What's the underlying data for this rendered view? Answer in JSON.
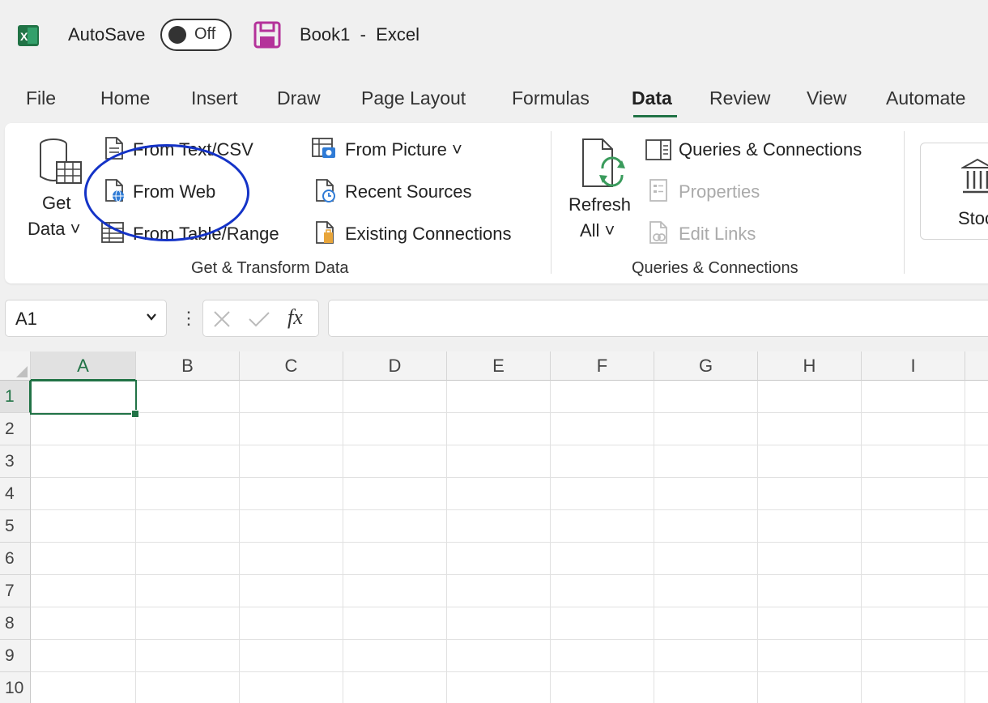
{
  "titlebar": {
    "autosave_label": "AutoSave",
    "autosave_state": "Off",
    "doc_title": "Book1  -  Excel",
    "icons": [
      "excel-logo-icon",
      "save-icon"
    ],
    "colors": {
      "excel_green": "#217346",
      "save_purple": "#b4329a"
    }
  },
  "tabs": [
    {
      "label": "File"
    },
    {
      "label": "Home"
    },
    {
      "label": "Insert"
    },
    {
      "label": "Draw"
    },
    {
      "label": "Page Layout"
    },
    {
      "label": "Formulas"
    },
    {
      "label": "Data",
      "active": true
    },
    {
      "label": "Review"
    },
    {
      "label": "View"
    },
    {
      "label": "Automate"
    }
  ],
  "ribbon": {
    "get_data": {
      "line1": "Get",
      "line2": "Data ˅"
    },
    "from_text_csv": "From Text/CSV",
    "from_web": "From Web",
    "from_table_range": "From Table/Range",
    "from_picture": "From Picture ˅",
    "recent_sources": "Recent Sources",
    "existing_connections": "Existing Connections",
    "group_get_transform": "Get & Transform Data",
    "refresh_all": {
      "line1": "Refresh",
      "line2": "All ˅"
    },
    "queries_connections": "Queries & Connections",
    "properties": "Properties",
    "edit_links": "Edit Links",
    "group_queries": "Queries & Connections",
    "stocks_partial": "Stoc"
  },
  "formula_bar": {
    "name_box": "A1",
    "fx": "fx",
    "formula": ""
  },
  "grid": {
    "columns": [
      "A",
      "B",
      "C",
      "D",
      "E",
      "F",
      "G",
      "H",
      "I"
    ],
    "rows": [
      "1",
      "2",
      "3",
      "4",
      "5",
      "6",
      "7",
      "8",
      "9",
      "10"
    ],
    "selected_cell": "A1"
  },
  "annotation": {
    "shape": "ellipse",
    "color": "#1433c7",
    "target": "From Web"
  }
}
